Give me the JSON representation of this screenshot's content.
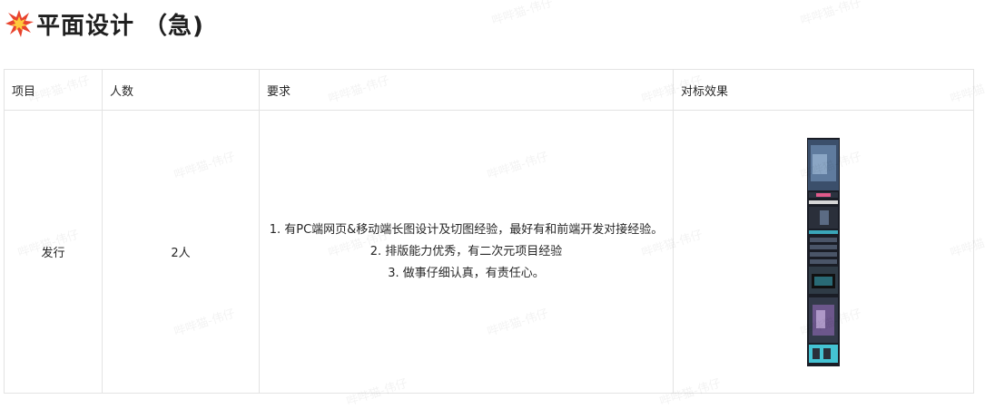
{
  "heading": {
    "icon": "collision-emoji-icon",
    "title": "平面设计 （急)"
  },
  "table": {
    "headers": [
      "项目",
      "人数",
      "要求",
      "对标效果"
    ],
    "row": {
      "project": "发行",
      "headcount": "2人",
      "requirements": [
        "1. 有PC端网页&移动端长图设计及切图经验，最好有和前端开发对接经验。",
        "2. 排版能力优秀，有二次元项目经验",
        "3. 做事仔细认真，有责任心。"
      ],
      "reference": "reference-long-image-thumbnail"
    }
  },
  "watermark": "哔哔猫-伟仔"
}
